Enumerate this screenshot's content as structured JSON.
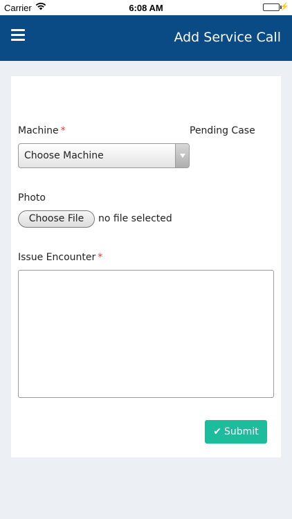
{
  "status_bar": {
    "carrier": "Carrier",
    "time": "6:08 AM",
    "wifi_icon": "wifi-icon",
    "battery_icon": "battery-icon",
    "charging_icon": "bolt-icon"
  },
  "nav": {
    "title": "Add Service Call",
    "menu_icon": "hamburger-menu-icon",
    "background": "#0a4a85"
  },
  "form": {
    "machine_label": "Machine",
    "required_mark": "*",
    "pending_label": "Pending Case",
    "machine_select_value": "Choose Machine",
    "photo_label": "Photo",
    "file_button_label": "Choose File",
    "file_status": "no file selected",
    "issue_label": "Issue Encounter",
    "issue_value": "",
    "submit_label": "Submit",
    "submit_icon": "check-icon",
    "submit_color": "#1cbc9c",
    "required_color": "#e53935"
  }
}
